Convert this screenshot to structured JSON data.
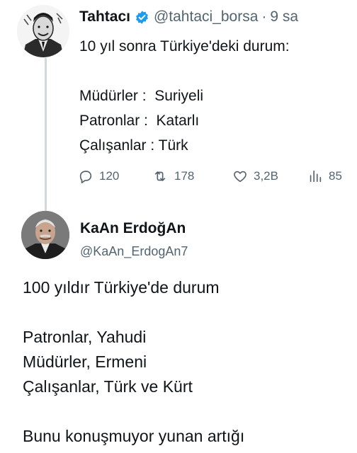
{
  "tweet1": {
    "author_name": "Tahtacı",
    "handle": "@tahtaci_borsa",
    "separator": "·",
    "time": "9 sa",
    "lines": [
      "10 yıl sonra Türkiye'deki durum:",
      "",
      "Müdürler :  Suriyeli",
      "Patronlar :  Katarlı",
      "Çalışanlar : Türk"
    ],
    "actions": {
      "replies": "120",
      "retweets": "178",
      "likes": "3,2B",
      "views": "85"
    }
  },
  "tweet2": {
    "author_name": "KaAn ErdoğAn",
    "handle": "@KaAn_ErdogAn7",
    "lines": [
      "100 yıldır Türkiye'de durum",
      "",
      "Patronlar, Yahudi",
      "Müdürler, Ermeni",
      "Çalışanlar, Türk ve Kürt",
      "",
      "Bunu konuşmuyor yunan artığı"
    ]
  },
  "colors": {
    "text": "#0f1419",
    "secondary": "#536471",
    "verified": "#1d9bf0",
    "thread_line": "#cfd9de"
  },
  "icons": [
    "verified-badge-icon",
    "reply-icon",
    "retweet-icon",
    "like-icon",
    "views-icon"
  ]
}
